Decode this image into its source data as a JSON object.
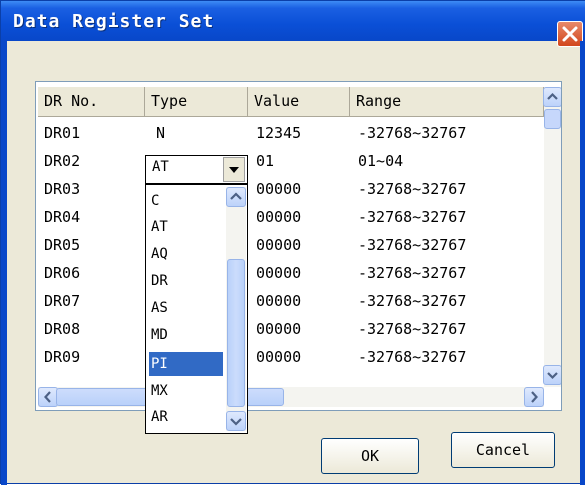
{
  "window": {
    "title": "Data Register Set"
  },
  "table": {
    "columns": [
      "DR No.",
      "Type",
      "Value",
      "Range"
    ],
    "rows": [
      {
        "no": "DR01",
        "type": "N",
        "value": "12345",
        "range": "-32768~32767"
      },
      {
        "no": "DR02",
        "type": "AT",
        "value": "01",
        "range": "01~04"
      },
      {
        "no": "DR03",
        "type": "",
        "value": "00000",
        "range": "-32768~32767"
      },
      {
        "no": "DR04",
        "type": "",
        "value": "00000",
        "range": "-32768~32767"
      },
      {
        "no": "DR05",
        "type": "",
        "value": "00000",
        "range": "-32768~32767"
      },
      {
        "no": "DR06",
        "type": "",
        "value": "00000",
        "range": "-32768~32767"
      },
      {
        "no": "DR07",
        "type": "",
        "value": "00000",
        "range": "-32768~32767"
      },
      {
        "no": "DR08",
        "type": "",
        "value": "00000",
        "range": "-32768~32767"
      },
      {
        "no": "DR09",
        "type": "",
        "value": "00000",
        "range": "-32768~32767"
      }
    ]
  },
  "type_dropdown": {
    "current_value": "AT",
    "options": [
      "C",
      "AT",
      "AQ",
      "DR",
      "AS",
      "MD",
      "PI",
      "MX",
      "AR"
    ],
    "highlighted": "PI"
  },
  "buttons": {
    "ok": "OK",
    "cancel": "Cancel"
  },
  "colors": {
    "title_bar": "#0a4fd6",
    "selection": "#316ac5",
    "dialog_face": "#ece9d8",
    "close_button": "#d2461c"
  }
}
